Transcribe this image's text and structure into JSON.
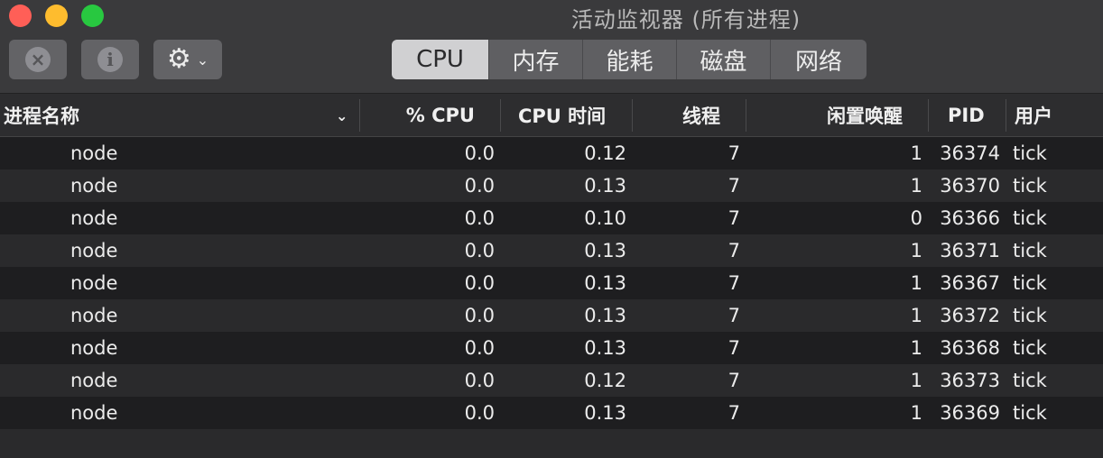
{
  "window": {
    "title": "活动监视器 (所有进程)"
  },
  "toolbar": {
    "stop_icon": "×",
    "info_icon": "i",
    "gear_icon": "⚙",
    "chevron_icon": "⌄",
    "tabs": [
      {
        "label": "CPU",
        "active": true
      },
      {
        "label": "内存",
        "active": false
      },
      {
        "label": "能耗",
        "active": false
      },
      {
        "label": "磁盘",
        "active": false
      },
      {
        "label": "网络",
        "active": false
      }
    ]
  },
  "table": {
    "columns": {
      "name": "进程名称",
      "sort_icon": "⌄",
      "cpu": "% CPU",
      "cpu_time": "CPU 时间",
      "threads": "线程",
      "idle_wakeups": "闲置唤醒",
      "pid": "PID",
      "user": "用户"
    },
    "rows": [
      {
        "name": "node",
        "cpu": "0.0",
        "cpu_time": "0.12",
        "threads": "7",
        "idle_wakeups": "1",
        "pid": "36374",
        "user": "tick"
      },
      {
        "name": "node",
        "cpu": "0.0",
        "cpu_time": "0.13",
        "threads": "7",
        "idle_wakeups": "1",
        "pid": "36370",
        "user": "tick"
      },
      {
        "name": "node",
        "cpu": "0.0",
        "cpu_time": "0.10",
        "threads": "7",
        "idle_wakeups": "0",
        "pid": "36366",
        "user": "tick"
      },
      {
        "name": "node",
        "cpu": "0.0",
        "cpu_time": "0.13",
        "threads": "7",
        "idle_wakeups": "1",
        "pid": "36371",
        "user": "tick"
      },
      {
        "name": "node",
        "cpu": "0.0",
        "cpu_time": "0.13",
        "threads": "7",
        "idle_wakeups": "1",
        "pid": "36367",
        "user": "tick"
      },
      {
        "name": "node",
        "cpu": "0.0",
        "cpu_time": "0.13",
        "threads": "7",
        "idle_wakeups": "1",
        "pid": "36372",
        "user": "tick"
      },
      {
        "name": "node",
        "cpu": "0.0",
        "cpu_time": "0.13",
        "threads": "7",
        "idle_wakeups": "1",
        "pid": "36368",
        "user": "tick"
      },
      {
        "name": "node",
        "cpu": "0.0",
        "cpu_time": "0.12",
        "threads": "7",
        "idle_wakeups": "1",
        "pid": "36373",
        "user": "tick"
      },
      {
        "name": "node",
        "cpu": "0.0",
        "cpu_time": "0.13",
        "threads": "7",
        "idle_wakeups": "1",
        "pid": "36369",
        "user": "tick"
      }
    ]
  }
}
